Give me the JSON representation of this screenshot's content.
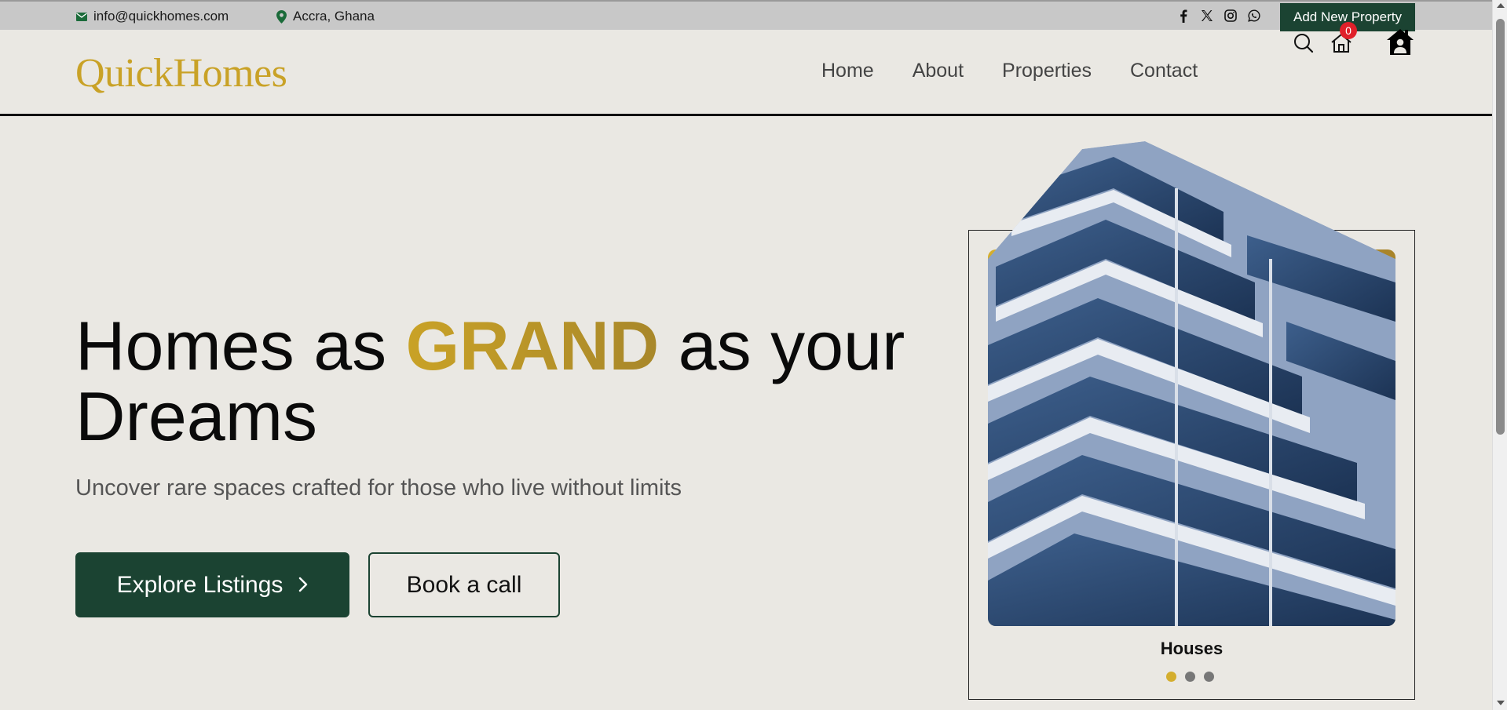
{
  "topbar": {
    "email": "info@quickhomes.com",
    "location": "Accra, Ghana",
    "socials": [
      "facebook-icon",
      "x-icon",
      "instagram-icon",
      "whatsapp-icon"
    ],
    "add_property": "Add New Property"
  },
  "header": {
    "logo": "QuickHomes",
    "nav": [
      "Home",
      "About",
      "Properties",
      "Contact"
    ],
    "cart_count": "0"
  },
  "hero": {
    "title_prefix": "Homes as ",
    "title_highlight": "GRAND",
    "title_suffix": " as your Dreams",
    "subtitle": "Uncover rare spaces crafted for those who live without limits",
    "explore_label": "Explore Listings",
    "book_label": "Book a call"
  },
  "card": {
    "label": "Houses",
    "dots": 3,
    "active_dot": 1
  },
  "colors": {
    "brand_green": "#1b4332",
    "gold": "#c9a227",
    "background": "#eae8e3"
  }
}
